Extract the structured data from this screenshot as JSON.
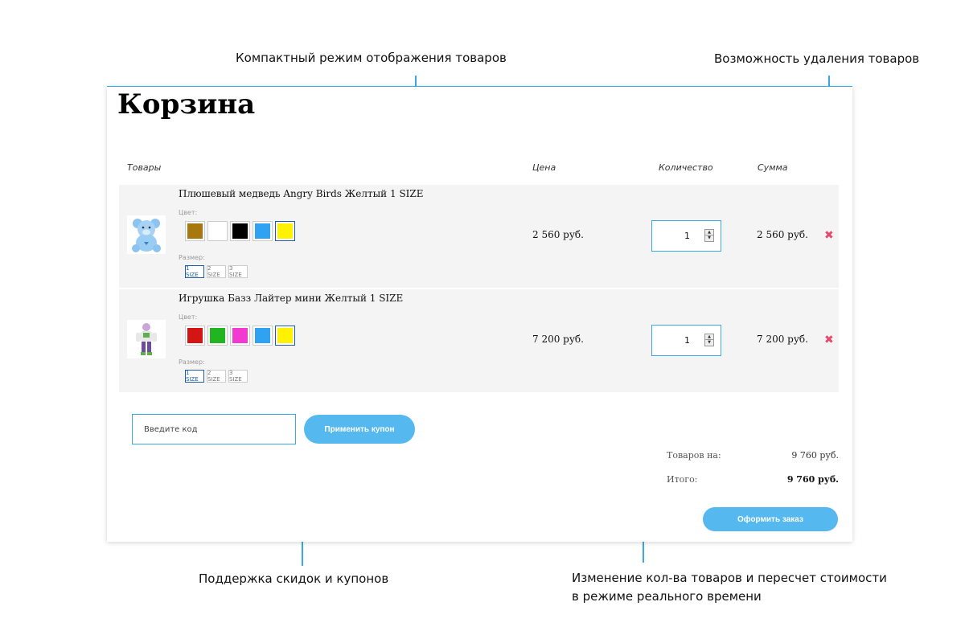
{
  "annotations": {
    "compact_mode": "Компактный режим отображения товаров",
    "delete_items": "Возможность удаления товаров",
    "coupons": "Поддержка скидок и купонов",
    "qty_line1": "Изменение кол-ва товаров и пересчет стоимости",
    "qty_line2": "в режиме реального времени"
  },
  "cart": {
    "title": "Корзина",
    "headers": {
      "items": "Товары",
      "price": "Цена",
      "quantity": "Количество",
      "sum": "Сумма"
    },
    "color_label": "Цвет:",
    "size_label": "Размер:",
    "sizes": [
      "1 SIZE",
      "2 SIZE",
      "3 SIZE"
    ],
    "delete_icon": "close-icon",
    "items": [
      {
        "name": "Плюшевый медведь Angry Birds Желтый 1 SIZE",
        "thumb_icon": "teddy-bear-icon",
        "colors": [
          "#a8770f",
          "#ffffff",
          "#000000",
          "#2fa3f2",
          "#fff200"
        ],
        "selected_color": 4,
        "selected_size": 0,
        "price": "2 560 руб.",
        "quantity": "1",
        "sum": "2 560 руб."
      },
      {
        "name": "Игрушка Базз Лайтер мини Желтый 1 SIZE",
        "thumb_icon": "buzz-toy-icon",
        "colors": [
          "#d41515",
          "#22b522",
          "#f23ad0",
          "#2fa3f2",
          "#fff200"
        ],
        "selected_color": 4,
        "selected_size": 0,
        "price": "7 200 руб.",
        "quantity": "1",
        "sum": "7 200 руб."
      }
    ],
    "coupon_placeholder": "Введите код",
    "coupon_button": "Применить купон",
    "subtotal_label": "Товаров на:",
    "subtotal_value": "9 760 руб.",
    "total_label": "Итого:",
    "total_value": "9 760 руб.",
    "order_button": "Оформить заказ"
  },
  "colors": {
    "accent": "#3aa8e6",
    "button": "#55b9f0",
    "delete": "#e44b6b",
    "row_bg": "#f4f4f4"
  }
}
